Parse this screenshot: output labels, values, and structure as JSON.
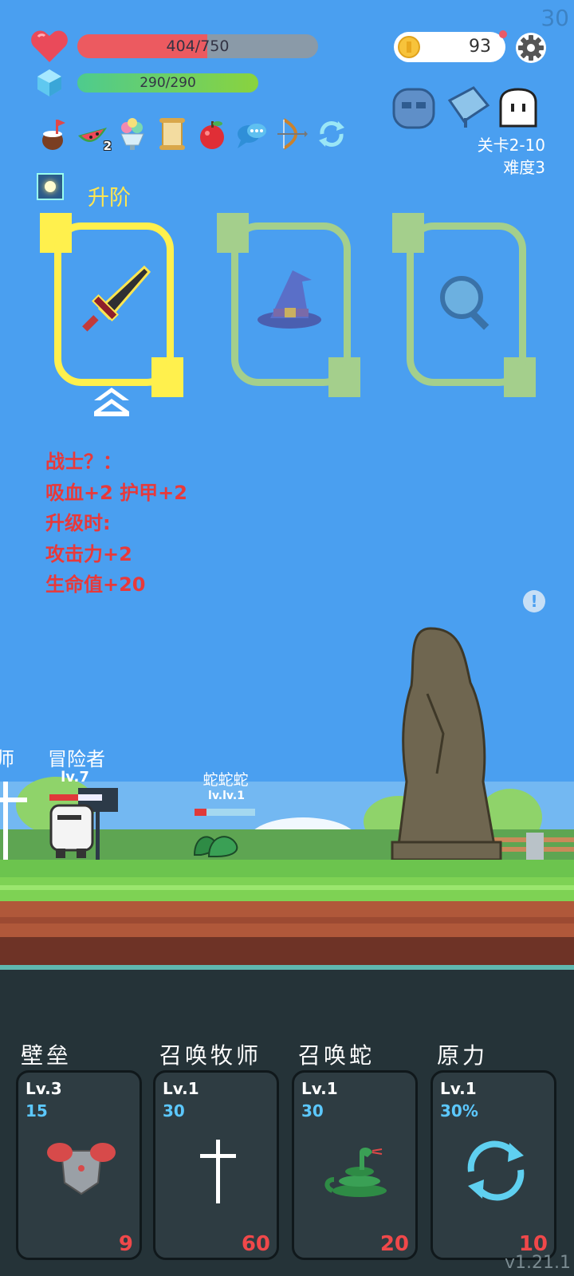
{
  "fps": "30",
  "player": {
    "hp_text": "404/750",
    "hp_fraction": 0.539,
    "mp_text": "290/290",
    "mp_fraction": 1.0
  },
  "coins": "93",
  "stage": {
    "level": "关卡2-10",
    "difficulty": "难度3"
  },
  "inventory": [
    {
      "icon": "coconut-drink-icon",
      "count": ""
    },
    {
      "icon": "watermelon-icon",
      "count": "2"
    },
    {
      "icon": "ice-cream-icon",
      "count": ""
    },
    {
      "icon": "scroll-icon",
      "count": ""
    },
    {
      "icon": "apple-icon",
      "count": ""
    },
    {
      "icon": "speech-bubble-icon",
      "count": ""
    },
    {
      "icon": "bow-icon",
      "count": ""
    },
    {
      "icon": "refresh-icon",
      "count": ""
    }
  ],
  "upgrade": {
    "title": "升阶",
    "cards": [
      {
        "icon": "sword-icon",
        "selected": true
      },
      {
        "icon": "wizard-hat-icon",
        "selected": false
      },
      {
        "icon": "magnifier-icon",
        "selected": false
      }
    ],
    "description": [
      "战士？：",
      "吸血+2 护甲+2",
      "升级时:",
      "攻击力+2",
      "生命值+20"
    ]
  },
  "scene": {
    "hero": {
      "name": "冒险者",
      "level": "lv.7",
      "hp_fraction": 0.55
    },
    "left_ally": {
      "name": "师"
    },
    "enemy": {
      "name": "蛇蛇蛇",
      "level": "lv.lv.1",
      "hp_fraction": 0.2
    }
  },
  "skills": [
    {
      "title": "壁垒",
      "level": "Lv.3",
      "value": "15",
      "cost": "9",
      "icon": "armor-icon"
    },
    {
      "title": "召唤牧师",
      "level": "Lv.1",
      "value": "30",
      "cost": "60",
      "icon": "cross-icon"
    },
    {
      "title": "召唤蛇",
      "level": "Lv.1",
      "value": "30",
      "cost": "20",
      "icon": "snake-icon"
    },
    {
      "title": "原力",
      "level": "Lv.1",
      "value": "30%",
      "cost": "10",
      "icon": "force-cycle-icon"
    }
  ],
  "version": "v1.21.1",
  "colors": {
    "sky": "#4a9ff0",
    "hp": "#ec5a60",
    "mp": "#8ad33e",
    "upgrade_text": "#ffe650",
    "desc_text": "#e8393a",
    "panel": "#253338"
  }
}
